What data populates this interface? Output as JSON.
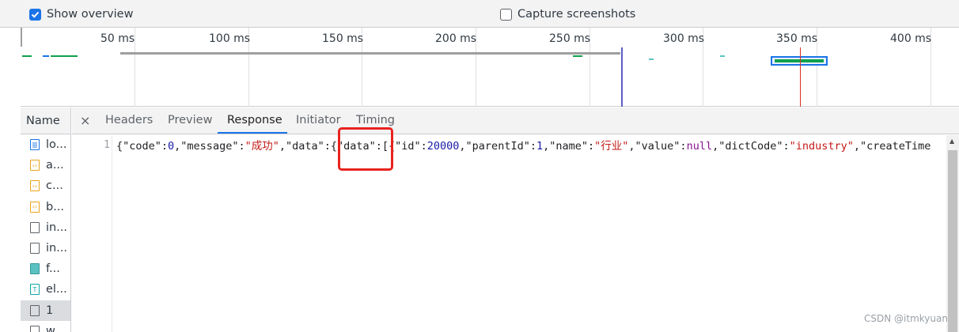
{
  "toolbar": {
    "show_overview": {
      "label": "Show overview",
      "checked": true
    },
    "capture_screenshots": {
      "label": "Capture screenshots",
      "checked": false
    }
  },
  "overview": {
    "ticks": [
      "50 ms",
      "100 ms",
      "150 ms",
      "200 ms",
      "250 ms",
      "300 ms",
      "350 ms",
      "400 ms"
    ],
    "colors": {
      "blue_marker": "#5b5fc7",
      "red_marker": "#d93025",
      "bar_green": "#0fa14c",
      "bar_blue": "#1a73e8",
      "bar_gray": "#9e9e9e"
    }
  },
  "name_column": {
    "header": "Name",
    "rows": [
      {
        "label": "lo...",
        "icon": "doc-icon"
      },
      {
        "label": "a...",
        "icon": "script-icon"
      },
      {
        "label": "c...",
        "icon": "script-icon"
      },
      {
        "label": "b...",
        "icon": "script-icon"
      },
      {
        "label": "in...",
        "icon": "blank-file-icon"
      },
      {
        "label": "in...",
        "icon": "blank-file-icon"
      },
      {
        "label": "f...",
        "icon": "image-icon"
      },
      {
        "label": "el...",
        "icon": "font-icon"
      },
      {
        "label": "1",
        "icon": "blank-file-icon"
      },
      {
        "label": "w...",
        "icon": "blank-file-icon"
      }
    ]
  },
  "tabs": {
    "close": "×",
    "items": [
      "Headers",
      "Preview",
      "Response",
      "Initiator",
      "Timing"
    ],
    "active": "Response"
  },
  "response": {
    "line_number": "1",
    "tokens": [
      {
        "t": "{\"code\":",
        "c": ""
      },
      {
        "t": "0",
        "c": "num"
      },
      {
        "t": ",\"message\":",
        "c": ""
      },
      {
        "t": "\"成功\"",
        "c": "str"
      },
      {
        "t": ",\"data\":{\"data\":[{\"id\":",
        "c": ""
      },
      {
        "t": "20000",
        "c": "num"
      },
      {
        "t": ",\"parentId\":",
        "c": ""
      },
      {
        "t": "1",
        "c": "num"
      },
      {
        "t": ",\"name\":",
        "c": ""
      },
      {
        "t": "\"行业\"",
        "c": "str"
      },
      {
        "t": ",\"value\":",
        "c": ""
      },
      {
        "t": "null",
        "c": "kw"
      },
      {
        "t": ",\"dictCode\":",
        "c": ""
      },
      {
        "t": "\"industry\"",
        "c": "str"
      },
      {
        "t": ",\"createTime",
        "c": ""
      }
    ]
  },
  "watermark": "CSDN @itmkyuan"
}
